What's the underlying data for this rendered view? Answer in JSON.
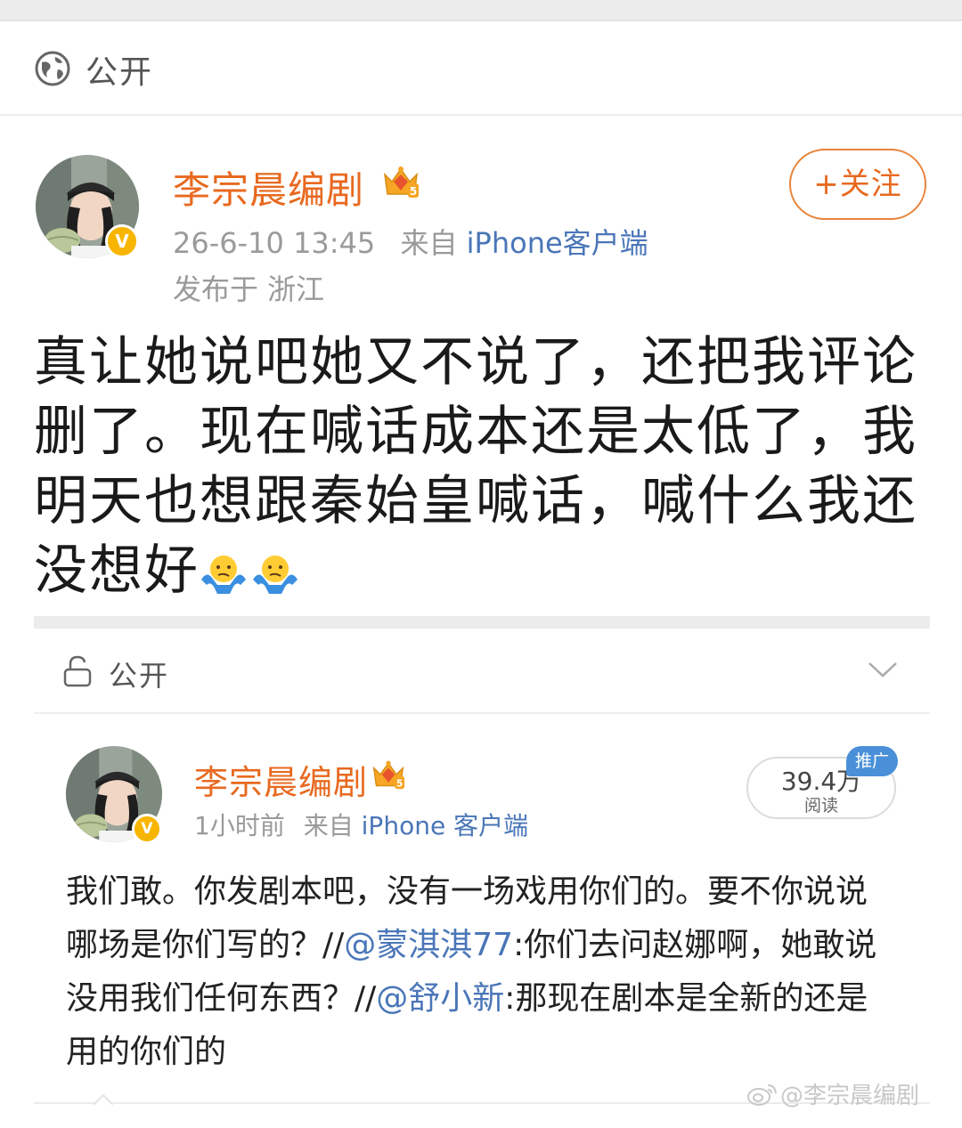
{
  "privacy": {
    "label": "公开"
  },
  "post": {
    "author": "李宗晨编剧",
    "timestamp": "26-6-10 13:45",
    "from_label": "来自",
    "source": "iPhone客户端",
    "location": "发布于 浙江",
    "follow_label": "+关注",
    "text": "真让她说吧她又不说了，还把我评论删了。现在喊话成本还是太低了，我明天也想跟秦始皇喊话，喊什么我还没想好",
    "emojis": [
      "shrug-emoji",
      "shrug-emoji"
    ]
  },
  "privacy2": {
    "label": "公开"
  },
  "repost": {
    "author": "李宗晨编剧",
    "time": "1小时前",
    "from_label": "来自",
    "source": "iPhone 客户端",
    "reads_count": "39.4万",
    "reads_label": "阅读",
    "promo_badge": "推广",
    "text_1": "我们敢。你发剧本吧，没有一场戏用你们的。要不你说说哪场是你们写的？//",
    "mention_1": "@蒙淇淇77",
    "text_2": ":你们去问赵娜啊，她敢说没用我们任何东西？//",
    "mention_2": "@舒小新",
    "text_3": ":那现在剧本是全新的还是用的你们的"
  },
  "watermark": "@李宗晨编剧",
  "colors": {
    "brand_orange": "#e8691f",
    "link_blue": "#4a76b8",
    "verified_gold": "#f7b500",
    "promo_blue": "#4a90d9"
  }
}
